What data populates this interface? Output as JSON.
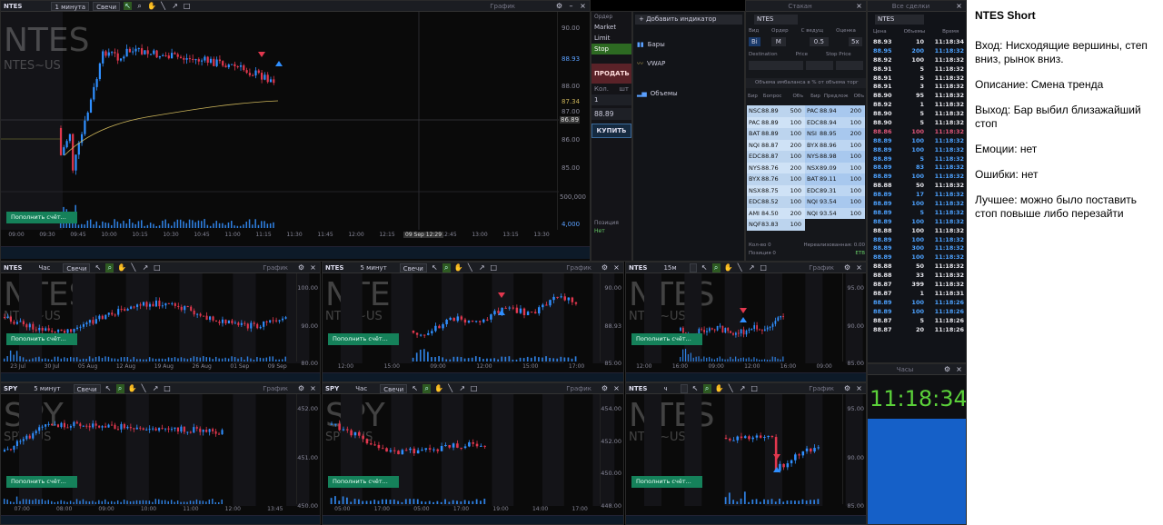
{
  "main_chart": {
    "symbol": "NTES",
    "timeframe": "1 минута",
    "chart_type": "Свечи",
    "title": "График",
    "watermark": "NTES",
    "watermark_sub": "NTES~US",
    "open_account": "Пополнить счёт...",
    "price_labels": [
      "90.00",
      "88.93",
      "88.00",
      "87.34",
      "87.00",
      "86.89",
      "86.00",
      "85.00",
      "500,000",
      "4,000"
    ],
    "time_labels": [
      "09:00",
      "09:30",
      "09:45",
      "10:00",
      "10:15",
      "10:30",
      "10:45",
      "11:00",
      "11:15",
      "11:30",
      "11:45",
      "12:00",
      "12:15",
      "12:30",
      "12:45",
      "13:00",
      "13:15",
      "13:30"
    ],
    "cursor_label": "09 Sep 12:29"
  },
  "order_entry": {
    "types": [
      "Ордер",
      "Market",
      "Limit",
      "Stop"
    ],
    "sell": "ПРОДАТЬ",
    "qty": "1",
    "price": "88.89",
    "buy": "КУПИТЬ",
    "position_label": "Позиция",
    "position_value": "Нет",
    "qty_label": "Кол.",
    "qty_unit": "шт"
  },
  "indicators": {
    "add": "+ Добавить индикатор",
    "items": [
      "Бары",
      "VWAP",
      "Объемы"
    ]
  },
  "level2": {
    "title": "Стакан",
    "symbol": "NTES",
    "fields": [
      "Вид",
      "Ордер",
      "Т",
      "С ведущ",
      "Оценка"
    ],
    "route_label": "Destination",
    "price_label": "Price",
    "stop_price_label": "Stop Price",
    "buttons": [
      "Bi",
      "M",
      "0.5",
      "5x"
    ],
    "imbalance": "Объема имбаланса в % от объема торг",
    "bid_header": [
      "Бир",
      "Бопрос",
      "Объ"
    ],
    "ask_header": [
      "Бир",
      "Предлож",
      "Объ"
    ],
    "bids": [
      [
        "NSC",
        "88.89",
        "500"
      ],
      [
        "PAC",
        "88.89",
        "100"
      ],
      [
        "BAT",
        "88.89",
        "100"
      ],
      [
        "NQI",
        "88.87",
        "200"
      ],
      [
        "EDC",
        "88.87",
        "100"
      ],
      [
        "NYS",
        "88.76",
        "200"
      ],
      [
        "BYX",
        "88.76",
        "100"
      ],
      [
        "NSX",
        "88.75",
        "100"
      ],
      [
        "EDC",
        "88.52",
        "100"
      ],
      [
        "AMI",
        "84.50",
        "200"
      ],
      [
        "NQF",
        "83.83",
        "100"
      ]
    ],
    "asks": [
      [
        "PAC",
        "88.94",
        "200"
      ],
      [
        "EDC",
        "88.94",
        "100"
      ],
      [
        "NSI",
        "88.95",
        "200"
      ],
      [
        "BYX",
        "88.96",
        "100"
      ],
      [
        "NYS",
        "88.98",
        "100"
      ],
      [
        "NSX",
        "89.09",
        "100"
      ],
      [
        "BAT",
        "89.11",
        "100"
      ],
      [
        "EDC",
        "89.31",
        "100"
      ],
      [
        "NQI",
        "93.54",
        "100"
      ],
      [
        "NQI",
        "93.54",
        "100"
      ]
    ],
    "footer_left": "Кол-во 0",
    "footer_mid": "Нереализованная: 0.00",
    "footer_pos": "Позиция 0",
    "footer_right": "ETB"
  },
  "time_sales": {
    "title": "Все сделки",
    "symbol": "NTES",
    "headers": [
      "Цена",
      "Объемы",
      "Время"
    ],
    "rows": [
      [
        "88.93",
        "10",
        "11:18:34",
        "w"
      ],
      [
        "88.95",
        "200",
        "11:18:32",
        "b"
      ],
      [
        "88.92",
        "100",
        "11:18:32",
        "w"
      ],
      [
        "88.91",
        "5",
        "11:18:32",
        "w"
      ],
      [
        "88.91",
        "5",
        "11:18:32",
        "w"
      ],
      [
        "88.91",
        "3",
        "11:18:32",
        "w"
      ],
      [
        "88.90",
        "95",
        "11:18:32",
        "w"
      ],
      [
        "88.92",
        "1",
        "11:18:32",
        "w"
      ],
      [
        "88.90",
        "5",
        "11:18:32",
        "w"
      ],
      [
        "88.90",
        "5",
        "11:18:32",
        "w"
      ],
      [
        "88.86",
        "100",
        "11:18:32",
        "r"
      ],
      [
        "88.89",
        "100",
        "11:18:32",
        "b"
      ],
      [
        "88.89",
        "100",
        "11:18:32",
        "b"
      ],
      [
        "88.89",
        "5",
        "11:18:32",
        "b"
      ],
      [
        "88.89",
        "83",
        "11:18:32",
        "b"
      ],
      [
        "88.89",
        "100",
        "11:18:32",
        "b"
      ],
      [
        "88.88",
        "50",
        "11:18:32",
        "w"
      ],
      [
        "88.89",
        "17",
        "11:18:32",
        "b"
      ],
      [
        "88.89",
        "100",
        "11:18:32",
        "b"
      ],
      [
        "88.89",
        "5",
        "11:18:32",
        "b"
      ],
      [
        "88.89",
        "100",
        "11:18:32",
        "b"
      ],
      [
        "88.88",
        "100",
        "11:18:32",
        "w"
      ],
      [
        "88.89",
        "100",
        "11:18:32",
        "b"
      ],
      [
        "88.89",
        "300",
        "11:18:32",
        "b"
      ],
      [
        "88.89",
        "100",
        "11:18:32",
        "b"
      ],
      [
        "88.88",
        "50",
        "11:18:32",
        "w"
      ],
      [
        "88.88",
        "33",
        "11:18:32",
        "w"
      ],
      [
        "88.87",
        "399",
        "11:18:32",
        "w"
      ],
      [
        "88.87",
        "1",
        "11:18:31",
        "w"
      ],
      [
        "88.89",
        "100",
        "11:18:26",
        "b"
      ],
      [
        "88.89",
        "100",
        "11:18:26",
        "b"
      ],
      [
        "88.87",
        "5",
        "11:18:26",
        "w"
      ],
      [
        "88.87",
        "20",
        "11:18:26",
        "w"
      ]
    ]
  },
  "clock": {
    "title": "Часы",
    "time": "11:18:34"
  },
  "small_charts": [
    {
      "symbol": "NTES",
      "timeframe": "Час",
      "type": "Свечи",
      "title": "График",
      "wm": "NTES",
      "wm_sub": "NTES~US",
      "btn": "Пополнить счёт...",
      "prices": [
        "100.00",
        "90.00",
        "80.00"
      ],
      "times": [
        "23 Jul",
        "30 Jul",
        "05 Aug",
        "12 Aug",
        "19 Aug",
        "26 Aug",
        "01 Sep",
        "09 Sep"
      ]
    },
    {
      "symbol": "NTES",
      "timeframe": "5 минут",
      "type": "Свечи",
      "title": "График",
      "wm": "NTES",
      "wm_sub": "NTES~US",
      "btn": "Пополнить счёт...",
      "prices": [
        "90.00",
        "88.93",
        "85.00"
      ],
      "times": [
        "12:00",
        "15:00",
        "09:00",
        "12:00",
        "15:00",
        "17:00"
      ]
    },
    {
      "symbol": "NTES",
      "timeframe": "15м",
      "type": "",
      "title": "График",
      "wm": "NTES",
      "wm_sub": "NTES~US",
      "btn": "Пополнить счёт...",
      "prices": [
        "95.00",
        "90.00",
        "85.00"
      ],
      "times": [
        "12:00",
        "16:00",
        "09:00",
        "12:00",
        "16:00",
        "09:00"
      ]
    },
    {
      "symbol": "SPY",
      "timeframe": "5 минут",
      "type": "Свечи",
      "title": "График",
      "wm": "SPY",
      "wm_sub": "SPY~US",
      "btn": "Пополнить счёт...",
      "prices": [
        "452.00",
        "451.00",
        "450.00"
      ],
      "times": [
        "07:00",
        "08:00",
        "09:00",
        "10:00",
        "11:00",
        "12:00",
        "13:45"
      ]
    },
    {
      "symbol": "SPY",
      "timeframe": "Час",
      "type": "Свечи",
      "title": "График",
      "wm": "SPY",
      "wm_sub": "SPY~US",
      "btn": "Пополнить счёт...",
      "prices": [
        "454.00",
        "452.00",
        "450.00",
        "448.00"
      ],
      "times": [
        "05:00",
        "17:00",
        "05:00",
        "17:00",
        "19:00",
        "14:00",
        "17:00"
      ]
    },
    {
      "symbol": "NTES",
      "timeframe": "ч",
      "type": "",
      "title": "График",
      "wm": "NTES",
      "wm_sub": "NTES~US",
      "btn": "Пополнить счёт...",
      "prices": [
        "95.00",
        "90.00",
        "85.00"
      ],
      "times": []
    }
  ],
  "notes": {
    "title": "NTES Short",
    "entry": "Вход: Нисходящие вершины, степ вниз, рынок вниз.",
    "description": "Описание: Смена тренда",
    "exit": "Выход: Бар выбил близажайший стоп",
    "emotions": "Емоции: нет",
    "errors": "Ошибки:  нет",
    "best": "Лучшее: можно было поставить стоп повыше либо перезайти"
  }
}
